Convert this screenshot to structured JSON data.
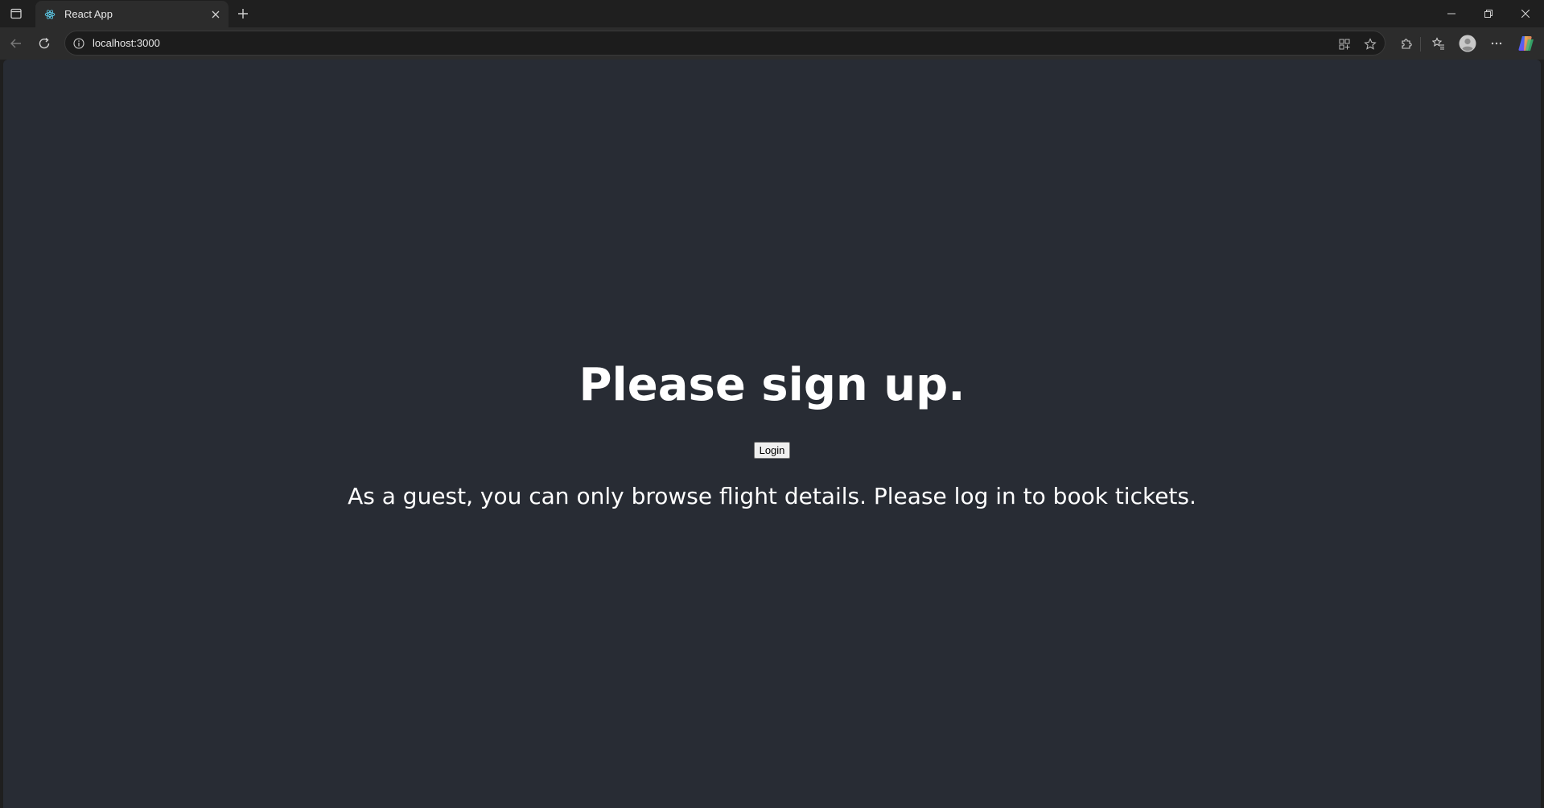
{
  "browser": {
    "tab": {
      "title": "React App",
      "favicon": "react-icon"
    },
    "address_bar": {
      "url": "localhost:3000"
    },
    "icons": {
      "tab_actions": "tab-actions-icon",
      "close_tab": "close-icon",
      "new_tab": "plus-icon",
      "minimize": "minimize-icon",
      "restore": "restore-icon",
      "close_window": "close-icon",
      "back": "back-arrow-icon",
      "refresh": "refresh-icon",
      "site_info": "info-icon",
      "app_available": "app-grid-icon",
      "favorite": "star-icon",
      "extensions": "puzzle-icon",
      "favorites": "favorites-icon",
      "profile": "profile-avatar-icon",
      "menu": "more-icon",
      "copilot": "copilot-icon"
    }
  },
  "page": {
    "background": "#282c34",
    "text_color": "#ffffff",
    "headline": "Please sign up.",
    "login_button": "Login",
    "guest_message": "As a guest, you can only browse flight details. Please log in to book tickets."
  }
}
